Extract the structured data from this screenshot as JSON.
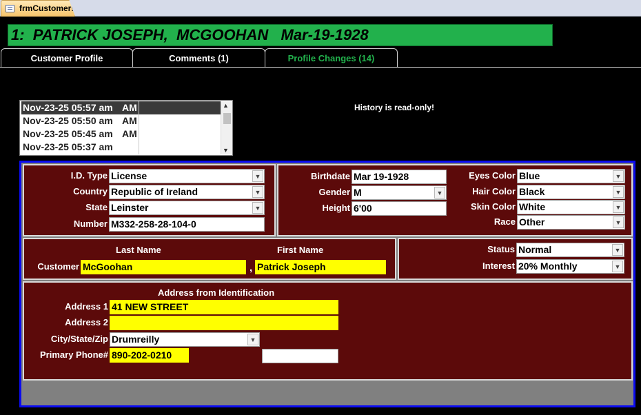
{
  "document_tab": {
    "label": "frmCustomers",
    "icon": "form-icon"
  },
  "header": {
    "title": "1:  PATRICK JOSEPH,  MCGOOHAN   Mar-19-1928"
  },
  "tabs": [
    {
      "label": "Customer Profile",
      "active": false
    },
    {
      "label": "Comments (1)",
      "active": false
    },
    {
      "label": "Profile Changes (14)",
      "active": true
    }
  ],
  "history": {
    "rows": [
      {
        "date": "Nov-23-25 05:57 am",
        "period": "AM",
        "selected": true
      },
      {
        "date": "Nov-23-25 05:50 am",
        "period": "AM",
        "selected": false
      },
      {
        "date": "Nov-23-25 05:45 am",
        "period": "AM",
        "selected": false
      },
      {
        "date": "Nov-23-25 05:37 am",
        "period": "",
        "selected": false
      }
    ],
    "note": "History is read-only!"
  },
  "identification": {
    "id_type_label": "I.D. Type",
    "id_type": "License",
    "country_label": "Country",
    "country": "Republic of Ireland",
    "state_label": "State",
    "state": "Leinster",
    "number_label": "Number",
    "number": "M332-258-28-104-0"
  },
  "physical": {
    "birthdate_label": "Birthdate",
    "birthdate": "Mar 19-1928",
    "gender_label": "Gender",
    "gender": "M",
    "height_label": "Height",
    "height": "6'00",
    "eyes_label": "Eyes Color",
    "eyes": "Blue",
    "hair_label": "Hair Color",
    "hair": "Black",
    "skin_label": "Skin Color",
    "skin": "White",
    "race_label": "Race",
    "race": "Other"
  },
  "name": {
    "last_name_header": "Last Name",
    "first_name_header": "First Name",
    "customer_label": "Customer",
    "last_name": "McGoohan",
    "separator": ",",
    "first_name": "Patrick Joseph"
  },
  "status": {
    "status_label": "Status",
    "status": "Normal",
    "interest_label": "Interest",
    "interest": "20% Monthly"
  },
  "address": {
    "heading": "Address from Identification",
    "address1_label": "Address 1",
    "address1": "41 NEW STREET",
    "address2_label": "Address 2",
    "address2": "",
    "city_label": "City/State/Zip",
    "city": "Drumreilly",
    "phone_label": "Primary Phone#",
    "phone": "890-202-0210",
    "extra": ""
  },
  "colors": {
    "title_bg": "#22b14c",
    "panel_bg": "#5c0a0a",
    "frame_border": "#0b0bf0",
    "highlight_field": "#ffff00",
    "active_tab_text": "#22b14c"
  }
}
